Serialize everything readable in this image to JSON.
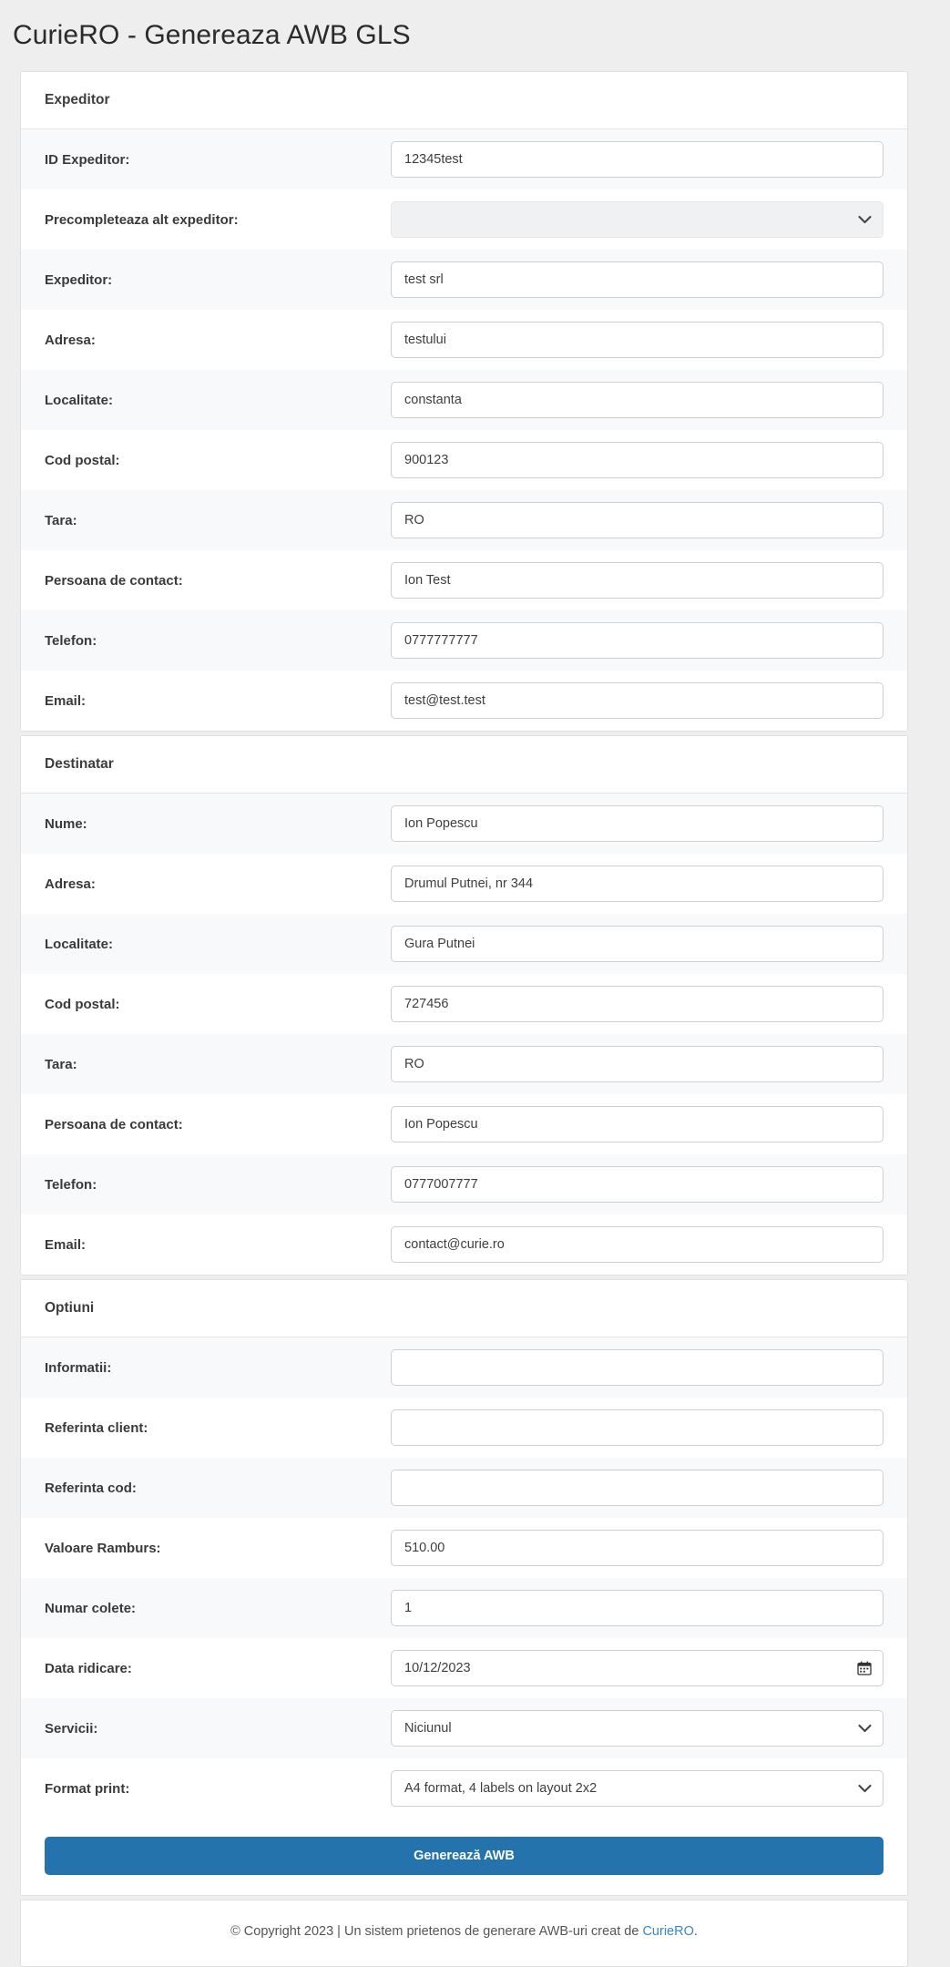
{
  "page": {
    "title": "CurieRO - Genereaza AWB GLS",
    "accent_color": "#2573ad",
    "link_color": "#3b86c4"
  },
  "sections": [
    {
      "id": "expeditor",
      "header": "Expeditor",
      "fields": [
        {
          "label": "ID Expeditor:",
          "type": "text",
          "value": "12345test",
          "placeholder": "",
          "name": "id-expeditor"
        },
        {
          "label": "Precompleteaza alt expeditor:",
          "type": "select-disabled",
          "value": "",
          "placeholder": "",
          "name": "precompleteaza-alt-expeditor"
        },
        {
          "label": "Expeditor:",
          "type": "text",
          "value": "test srl",
          "placeholder": "",
          "name": "expeditor-nume"
        },
        {
          "label": "Adresa:",
          "type": "text",
          "value": "testului",
          "placeholder": "",
          "name": "expeditor-adresa"
        },
        {
          "label": "Localitate:",
          "type": "text",
          "value": "constanta",
          "placeholder": "",
          "name": "expeditor-localitate"
        },
        {
          "label": "Cod postal:",
          "type": "text",
          "value": "900123",
          "placeholder": "",
          "name": "expeditor-cod-postal"
        },
        {
          "label": "Tara:",
          "type": "text",
          "value": "RO",
          "placeholder": "",
          "name": "expeditor-tara"
        },
        {
          "label": "Persoana de contact:",
          "type": "text",
          "value": "Ion Test",
          "placeholder": "",
          "name": "expeditor-persoana-contact"
        },
        {
          "label": "Telefon:",
          "type": "text",
          "value": "0777777777",
          "placeholder": "",
          "name": "expeditor-telefon"
        },
        {
          "label": "Email:",
          "type": "text",
          "value": "test@test.test",
          "placeholder": "",
          "name": "expeditor-email"
        }
      ]
    },
    {
      "id": "destinatar",
      "header": "Destinatar",
      "fields": [
        {
          "label": "Nume:",
          "type": "text",
          "value": "Ion Popescu",
          "placeholder": "",
          "name": "destinatar-nume"
        },
        {
          "label": "Adresa:",
          "type": "text",
          "value": "Drumul Putnei, nr 344",
          "placeholder": "",
          "name": "destinatar-adresa"
        },
        {
          "label": "Localitate:",
          "type": "text",
          "value": "Gura Putnei",
          "placeholder": "",
          "name": "destinatar-localitate"
        },
        {
          "label": "Cod postal:",
          "type": "text",
          "value": "727456",
          "placeholder": "",
          "name": "destinatar-cod-postal"
        },
        {
          "label": "Tara:",
          "type": "text",
          "value": "RO",
          "placeholder": "",
          "name": "destinatar-tara"
        },
        {
          "label": "Persoana de contact:",
          "type": "text",
          "value": "Ion Popescu",
          "placeholder": "",
          "name": "destinatar-persoana-contact"
        },
        {
          "label": "Telefon:",
          "type": "text",
          "value": "0777007777",
          "placeholder": "",
          "name": "destinatar-telefon"
        },
        {
          "label": "Email:",
          "type": "text",
          "value": "contact@curie.ro",
          "placeholder": "",
          "name": "destinatar-email"
        }
      ]
    },
    {
      "id": "optiuni",
      "header": "Optiuni",
      "fields": [
        {
          "label": "Informatii:",
          "type": "text",
          "value": "",
          "placeholder": "",
          "name": "informatii"
        },
        {
          "label": "Referinta client:",
          "type": "text",
          "value": "",
          "placeholder": "",
          "name": "referinta-client"
        },
        {
          "label": "Referinta cod:",
          "type": "text",
          "value": "",
          "placeholder": "",
          "name": "referinta-cod"
        },
        {
          "label": "Valoare Ramburs:",
          "type": "text",
          "value": "510.00",
          "placeholder": "",
          "name": "valoare-ramburs"
        },
        {
          "label": "Numar colete:",
          "type": "text",
          "value": "1",
          "placeholder": "",
          "name": "numar-colete"
        },
        {
          "label": "Data ridicare:",
          "type": "date",
          "value": "10/12/2023",
          "placeholder": "",
          "name": "data-ridicare"
        },
        {
          "label": "Servicii:",
          "type": "select",
          "value": "Niciunul",
          "placeholder": "",
          "name": "servicii"
        },
        {
          "label": "Format print:",
          "type": "select",
          "value": "A4 format, 4 labels on layout 2x2",
          "placeholder": "",
          "name": "format-print"
        }
      ]
    }
  ],
  "submit": {
    "label": "Generează AWB"
  },
  "footer": {
    "text_before": "© Copyright 2023 | Un sistem prietenos de generare AWB-uri creat de ",
    "link_label": "CurieRO",
    "text_after": "."
  },
  "icons": {
    "chevron_down": "chevron-down-icon",
    "calendar": "calendar-icon"
  }
}
